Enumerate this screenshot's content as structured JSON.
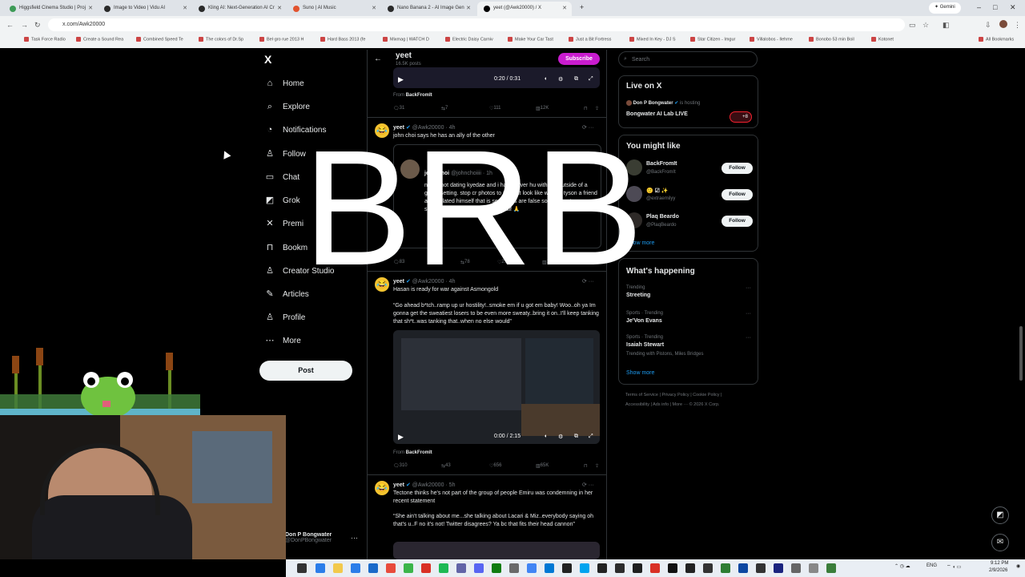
{
  "browser": {
    "tabs": [
      {
        "label": "Higgsfield Cinema Studio | Proj",
        "color": "#3d9b57",
        "active": false
      },
      {
        "label": "Image to Video | Vidu AI",
        "color": "#2a2a2a",
        "active": false
      },
      {
        "label": "Kling AI: Next-Generation AI Cr",
        "color": "#2a2a2a",
        "active": false
      },
      {
        "label": "Suno | AI Music",
        "color": "#e2542f",
        "active": false
      },
      {
        "label": "Nano Banana 2 - AI Image Gen",
        "color": "#2a2a2a",
        "active": false
      },
      {
        "label": "yeet (@Awk20000) / X",
        "color": "#000000",
        "active": true
      }
    ],
    "new_tab": "+",
    "gemini": "✦ Gemini",
    "url": "x.com/Awk20000",
    "bookmarks": [
      "Task Force Radio",
      "Create a Sound Rea",
      "Combined Speed Te",
      "The colors of Dr.Sp",
      "Bel·gro rue 2013 H",
      "Hard Bass 2013 (fe",
      "Mixmag | WATCH D",
      "Electric Daisy Carniv",
      "Make Your Car Tast",
      "Just a Bit Fortress",
      "Mixed In Key - DJ S",
      "Star Citizen - Imgur",
      "Villalobos - Ilehme",
      "Bonobo 53 min Boil",
      "Kotonet"
    ],
    "all_bookmarks": "All Bookmarks"
  },
  "nav": {
    "logo": "X",
    "items": [
      {
        "label": "Home",
        "icon": "⌂",
        "name": "home"
      },
      {
        "label": "Explore",
        "icon": "⌕",
        "name": "explore"
      },
      {
        "label": "Notifications",
        "icon": "◔",
        "name": "notifications"
      },
      {
        "label": "Follow",
        "icon": "♙",
        "name": "follow"
      },
      {
        "label": "Chat",
        "icon": "▭",
        "name": "chat"
      },
      {
        "label": "Grok",
        "icon": "◩",
        "name": "grok"
      },
      {
        "label": "Premi",
        "icon": "✕",
        "name": "premium"
      },
      {
        "label": "Bookm",
        "icon": "⊓",
        "name": "bookmarks"
      },
      {
        "label": "Creator Studio",
        "icon": "♙",
        "name": "creator-studio"
      },
      {
        "label": "Articles",
        "icon": "✎",
        "name": "articles"
      },
      {
        "label": "Profile",
        "icon": "♙",
        "name": "profile"
      },
      {
        "label": "More",
        "icon": "⋯",
        "name": "more"
      }
    ],
    "post": "Post",
    "account_name": "Don P Bongwater",
    "account_handle": "@DonPBongwater",
    "account_more": "···"
  },
  "feed": {
    "profile_name": "yeet",
    "profile_posts": "16.5K posts",
    "subscribe": "Subscribe",
    "first_video": {
      "time": "0:20 / 0:31",
      "from_label": "From",
      "from": "BackFromIt"
    },
    "first_stats": {
      "replies": "31",
      "reposts": "7",
      "likes": "111",
      "views": "12K"
    },
    "tweets": [
      {
        "name": "yeet",
        "handle": "@Awk20000 · 4h",
        "text": "john choi says he has an ally of the other",
        "quote_name": "john choi",
        "quote_handle": "@johnchoiiii · 1h",
        "quote_text": "no i'm not dating kyedae and i have never hu with her outside of a group setting. stop cr photos to make it look like we hav tyson a friend and isolated himself that is se rumors are false so please stop sending me th threats on his behalf 🙏",
        "stats": {
          "replies": "83",
          "reposts": "78",
          "likes": "2.3K",
          "views": "145K"
        }
      },
      {
        "name": "yeet",
        "handle": "@Awk20000 · 4h",
        "text": "Hasan is ready for war against Asmongold",
        "quote_text": "“Go ahead b*tch..ramp up ur hostility!..smoke em if u got em baby! Woo..oh ya Im gonna get the sweatiest losers to be even more sweaty..bring it on..I'll keep tanking that sh*t..was tanking that..when no else would”",
        "video_time": "0:00 / 2:15",
        "from_label": "From",
        "from": "BackFromIt",
        "stats": {
          "replies": "310",
          "reposts": "43",
          "likes": "656",
          "views": "65K"
        }
      },
      {
        "name": "yeet",
        "handle": "@Awk20000 · 5h",
        "text": "Tectone thinks he's not part of the group of people Emiru was condemning in her recent statement",
        "quote_text": "“She ain't talking about me...she talking about Lacari & Miz..everybody saying oh that's u..F no it's not! Twitter disagrees? Ya bc that fits their head cannon”"
      }
    ]
  },
  "sidebar": {
    "search_placeholder": "Search",
    "live": {
      "title": "Live on X",
      "host": "Don P Bongwater",
      "status": "is hosting",
      "space": "Bongwater AI Lab LIVE",
      "listeners": "+8"
    },
    "wtf": {
      "title": "You might like",
      "users": [
        {
          "name": "BackFromIt",
          "handle": "@BackFromIt",
          "follow": "Follow"
        },
        {
          "name": "🙂 ☑ ✨",
          "handle": "@extraemilyy",
          "follow": "Follow"
        },
        {
          "name": "Plaq Beardo",
          "handle": "@PlaqBeardo",
          "follow": "Follow"
        }
      ],
      "show_more": "Show more"
    },
    "happening": {
      "title": "What's happening",
      "trends": [
        {
          "context": "Trending",
          "topic": "Streeting",
          "extra": ""
        },
        {
          "context": "Sports · Trending",
          "topic": "Je'Von Evans",
          "extra": ""
        },
        {
          "context": "Sports · Trending",
          "topic": "Isaiah Stewart",
          "extra": "Trending with Pistons, Miles Bridges"
        }
      ],
      "show_more": "Show more"
    },
    "footer_line1": "Terms of Service  |  Privacy Policy  |  Cookie Policy  |",
    "footer_line2": "Accessibility  |  Ads info  |  More ···  © 2026 X Corp."
  },
  "overlay": {
    "brb": "BRB"
  },
  "taskbar": {
    "lang": "ENG",
    "time": "9:12 PM",
    "date": "2/9/2026"
  },
  "colors": {
    "accent": "#1d9bf0",
    "subscribe": "#c91ccf",
    "bg": "#000000",
    "border": "#2f3336"
  }
}
